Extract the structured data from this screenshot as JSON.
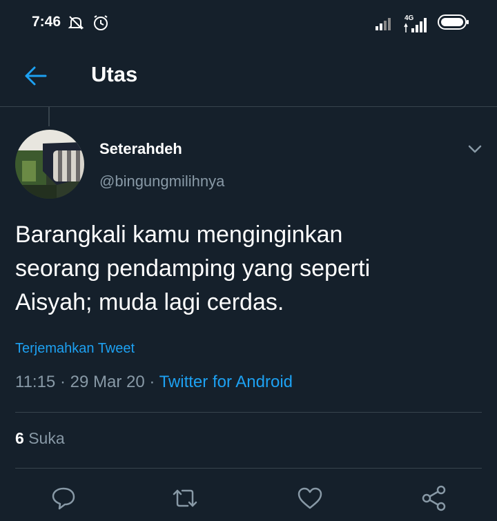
{
  "status_bar": {
    "time": "7:46",
    "network": "4G"
  },
  "nav": {
    "title": "Utas"
  },
  "tweet": {
    "display_name": "Seterahdeh",
    "handle": "@bingungmilihnya",
    "text_lines": [
      "Barangkali kamu menginginkan",
      "seorang pendamping yang seperti",
      "Aisyah; muda lagi cerdas."
    ],
    "translate_label": "Terjemahkan Tweet",
    "time": "11:15",
    "date": "29 Mar 20",
    "separator": "·",
    "source": "Twitter for Android",
    "likes_count": "6",
    "likes_label": "Suka"
  },
  "icons": {
    "back": "back-arrow-icon",
    "caret": "chevron-down-icon",
    "reply": "reply-icon",
    "retweet": "retweet-icon",
    "like": "heart-icon",
    "share": "share-icon"
  },
  "colors": {
    "background": "#15202b",
    "accent": "#1da1f2",
    "secondary_text": "#8899a6",
    "divider": "#38444d"
  }
}
